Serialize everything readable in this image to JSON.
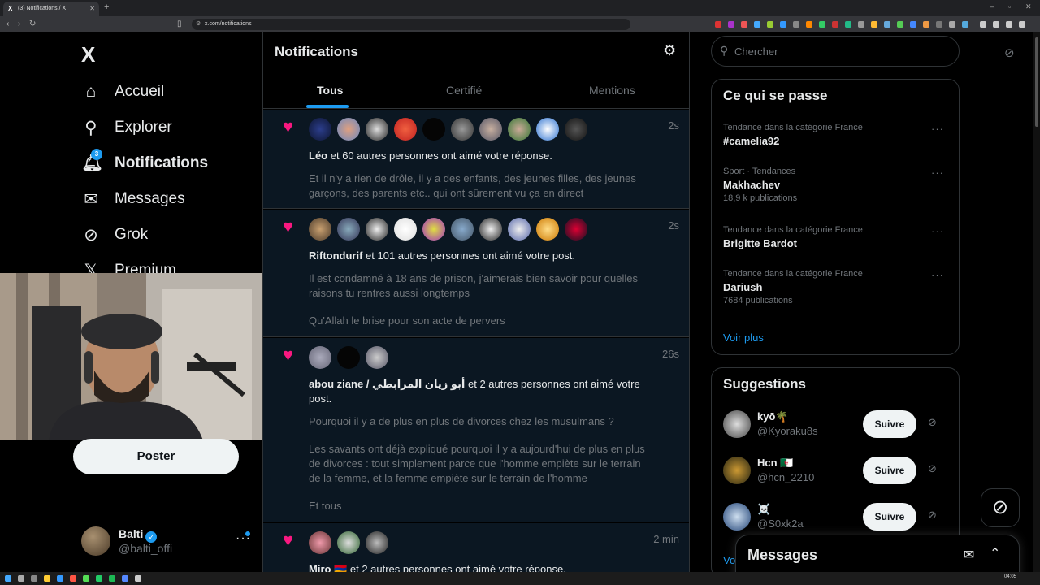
{
  "browser": {
    "tab_title": "(3) Notifications / X",
    "tab_icon": "X",
    "url": "x.com/notifications"
  },
  "nav": {
    "logo": "X",
    "items": [
      {
        "label": "Accueil",
        "icon": "home-icon"
      },
      {
        "label": "Explorer",
        "icon": "search-icon"
      },
      {
        "label": "Notifications",
        "icon": "bell-icon",
        "badge": "3"
      },
      {
        "label": "Messages",
        "icon": "mail-icon"
      },
      {
        "label": "Grok",
        "icon": "grok-icon"
      },
      {
        "label": "Premium",
        "icon": "x-icon"
      }
    ],
    "post_button": "Poster",
    "account": {
      "name": "Balti",
      "handle": "@balti_offi"
    }
  },
  "main": {
    "title": "Notifications",
    "tabs": [
      "Tous",
      "Certifié",
      "Mentions"
    ],
    "notifications": [
      {
        "time": "2s",
        "actor": "Léo",
        "text": " et 60 autres personnes ont aimé votre réponse.",
        "quote": "Et il n'y a rien de drôle, il y a des enfants, des jeunes filles, des jeunes garçons, des parents etc.. qui ont sûrement vu ça en direct"
      },
      {
        "time": "2s",
        "actor": "Riftondurif",
        "text": " et 101 autres personnes ont aimé votre post.",
        "quote": "Il est condamné à 18 ans de prison, j'aimerais bien savoir pour quelles raisons tu rentres aussi longtemps",
        "quote2": "Qu'Allah le brise pour son acte de pervers"
      },
      {
        "time": "26s",
        "actor": "abou ziane / أبو زيان المرابطي",
        "text": " et 2 autres personnes ont aimé votre post.",
        "quote": "Pourquoi il y a de plus en plus de divorces chez les musulmans ?",
        "quote2": "Les savants ont déjà expliqué pourquoi il y a aujourd'hui de plus en plus de divorces : tout simplement parce que l'homme empiète sur le terrain de la femme, et la femme empiète sur le terrain de l'homme",
        "quote3": "Et tous"
      },
      {
        "time": "2 min",
        "actor": "Miro 🇦🇲",
        "text": " et 2 autres personnes ont aimé votre réponse."
      }
    ]
  },
  "right": {
    "search_placeholder": "Chercher",
    "trends_title": "Ce qui se passe",
    "trends": [
      {
        "category": "Tendance dans la catégorie France",
        "title": "#camelia92",
        "count": ""
      },
      {
        "category": "Sport · Tendances",
        "title": "Makhachev",
        "count": "18,9 k publications"
      },
      {
        "category": "Tendance dans la catégorie France",
        "title": "Brigitte Bardot",
        "count": ""
      },
      {
        "category": "Tendance dans la catégorie France",
        "title": "Dariush",
        "count": "7684 publications"
      }
    ],
    "show_more": "Voir plus",
    "suggestions_title": "Suggestions",
    "suggestions": [
      {
        "name": "kyō🌴",
        "handle": "@Kyoraku8s",
        "button": "Suivre"
      },
      {
        "name": "Hcn 🇩🇿",
        "handle": "@hcn_2210",
        "button": "Suivre"
      },
      {
        "name": "☠️",
        "handle": "@S0xk2a",
        "button": "Suivre"
      }
    ],
    "suggestions_more": "Vo",
    "messages_drawer": "Messages"
  },
  "taskbar": {
    "clock": "04:05"
  }
}
